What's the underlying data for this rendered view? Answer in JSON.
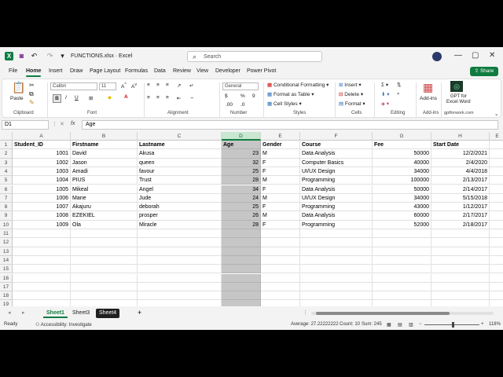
{
  "title_bar": {
    "file_title": "FUNCTIONS.xlsx  ·  Excel",
    "search_placeholder": "Search"
  },
  "ribbon_tabs": [
    "File",
    "Home",
    "Insert",
    "Draw",
    "Page Layout",
    "Formulas",
    "Data",
    "Review",
    "View",
    "Developer",
    "Power Pivot"
  ],
  "share_label": "Share",
  "ribbon": {
    "paste": "Paste",
    "clipboard": "Clipboard",
    "font_name": "Calibri",
    "font_size": "11",
    "font_group": "Font",
    "alignment_group": "Alignment",
    "number_format": "General",
    "number_group": "Number",
    "conditional_formatting": "Conditional Formatting",
    "format_as_table": "Format as Table",
    "cell_styles": "Cell Styles",
    "styles_group": "Styles",
    "insert": "Insert",
    "delete": "Delete",
    "format": "Format",
    "cells_group": "Cells",
    "editing_group": "Editing",
    "add_ins": "Add-ins",
    "add_ins_group": "Add-ins",
    "gpt_label_1": "GPT for",
    "gpt_label_2": "Excel Word",
    "gpt_group": "gptforwork.com"
  },
  "formula_bar": {
    "name_box": "D1",
    "fx": "fx",
    "formula": "Age"
  },
  "columns": [
    "A",
    "B",
    "C",
    "D",
    "E",
    "F",
    "G",
    "H"
  ],
  "selected_column": "D",
  "row_numbers": [
    "1",
    "2",
    "3",
    "4",
    "5",
    "6",
    "7",
    "8",
    "9",
    "10",
    "11",
    "12",
    "13",
    "14",
    "15",
    "16",
    "17",
    "18",
    "19"
  ],
  "table": {
    "headers": [
      "Student_ID",
      "Firstname",
      "Lastname",
      "Age",
      "Gender",
      "Course",
      "Fee",
      "Start Date"
    ],
    "rows": [
      [
        "1001",
        "David",
        "Akusa",
        "23",
        "M",
        "Data Analysis",
        "50000",
        "12/2/2021"
      ],
      [
        "1002",
        "Jason",
        "queen",
        "32",
        "F",
        "Computer Basics",
        "40000",
        "2/4/2020"
      ],
      [
        "1003",
        "Amadi",
        "favour",
        "25",
        "F",
        "UI/UX Design",
        "34000",
        "4/4/2018"
      ],
      [
        "1004",
        "PIUS",
        "Trust",
        "28",
        "M",
        "Programming",
        "100000",
        "2/13/2017"
      ],
      [
        "1005",
        "Mikeal",
        "Angel",
        "34",
        "F",
        "Data Analysis",
        "50000",
        "2/14/2017"
      ],
      [
        "1006",
        "Mane",
        "Jude",
        "24",
        "M",
        "UI/UX Design",
        "34000",
        "5/15/2018"
      ],
      [
        "1007",
        "Akajuru",
        "deborah",
        "25",
        "F",
        "Programming",
        "43000",
        "1/12/2017"
      ],
      [
        "1008",
        "EZEKIEL",
        "prosper",
        "26",
        "M",
        "Data Analysis",
        "60000",
        "2/17/2017"
      ],
      [
        "1009",
        "Ola",
        "Miracle",
        "28",
        "F",
        "Programming",
        "52000",
        "2/18/2017"
      ]
    ]
  },
  "sheet_tabs": [
    "Sheet1",
    "Sheet3",
    "Sheet4"
  ],
  "status": {
    "ready": "Ready",
    "accessibility": "Accessibility: Investigate",
    "average": "Average: 27.22222222",
    "count": "Count: 10",
    "sum": "Sum: 245",
    "zoom": "118%"
  },
  "colors": {
    "accent": "#107c41",
    "selection": "#c6c6c6"
  }
}
